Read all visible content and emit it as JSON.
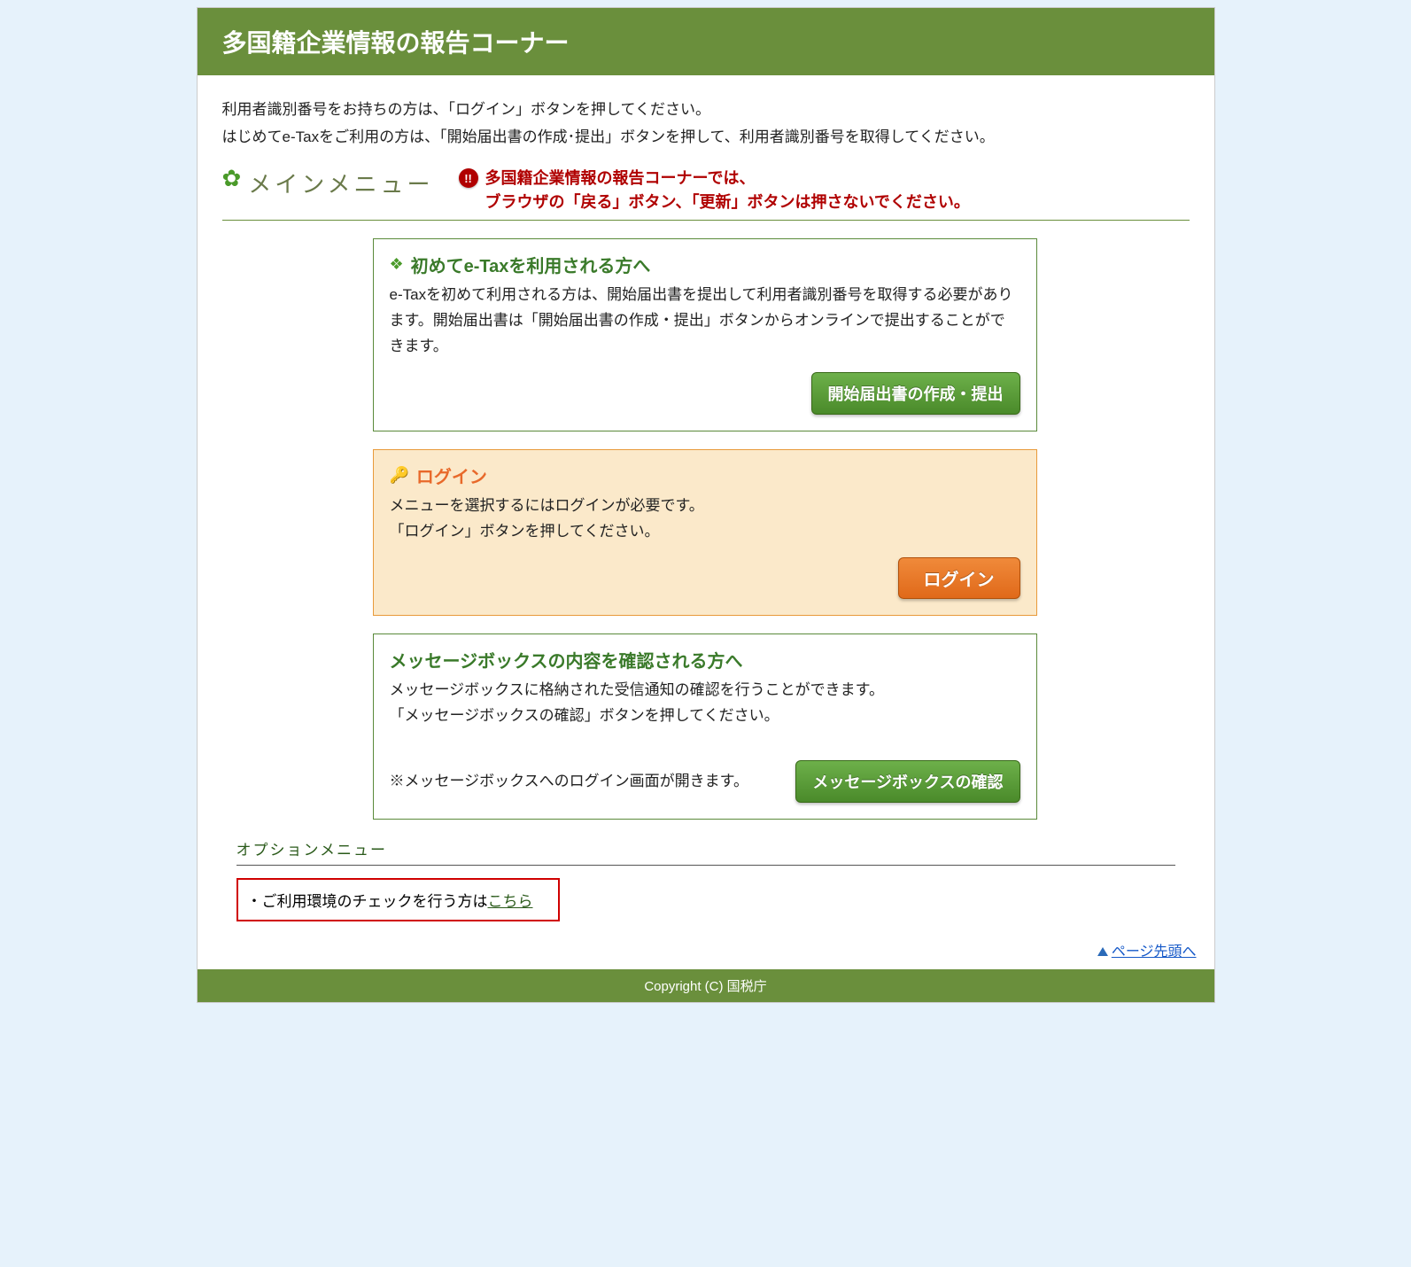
{
  "header": {
    "title": "多国籍企業情報の報告コーナー"
  },
  "intro": {
    "line1": "利用者識別番号をお持ちの方は、「ログイン」ボタンを押してください。",
    "line2": "はじめてe-Taxをご利用の方は、「開始届出書の作成･提出」ボタンを押して、利用者識別番号を取得してください。"
  },
  "mainmenu": {
    "label": "メインメニュー",
    "warning_line1": "多国籍企業情報の報告コーナーでは、",
    "warning_line2": "ブラウザの「戻る」ボタン、「更新」ボタンは押さないでください。",
    "warn_icon": "!!"
  },
  "panels": {
    "first_time": {
      "title": "初めてe-Taxを利用される方へ",
      "body": "e-Taxを初めて利用される方は、開始届出書を提出して利用者識別番号を取得する必要があります。開始届出書は「開始届出書の作成・提出」ボタンからオンラインで提出することができます。",
      "button": "開始届出書の作成・提出"
    },
    "login": {
      "title": "ログイン",
      "body_line1": "メニューを選択するにはログインが必要です。",
      "body_line2": "「ログイン」ボタンを押してください。",
      "button": "ログイン"
    },
    "msgbox": {
      "title": "メッセージボックスの内容を確認される方へ",
      "body_line1": "メッセージボックスに格納された受信通知の確認を行うことができます。",
      "body_line2": "「メッセージボックスの確認」ボタンを押してください。",
      "note": "※メッセージボックスへのログイン画面が開きます。",
      "button": "メッセージボックスの確認"
    }
  },
  "option": {
    "heading": "オプションメニュー",
    "item_prefix": "・ご利用環境のチェックを行う方は",
    "item_link": "こちら"
  },
  "pagetop": {
    "label": "ページ先頭へ"
  },
  "footer": {
    "copyright": "Copyright (C) 国税庁"
  }
}
